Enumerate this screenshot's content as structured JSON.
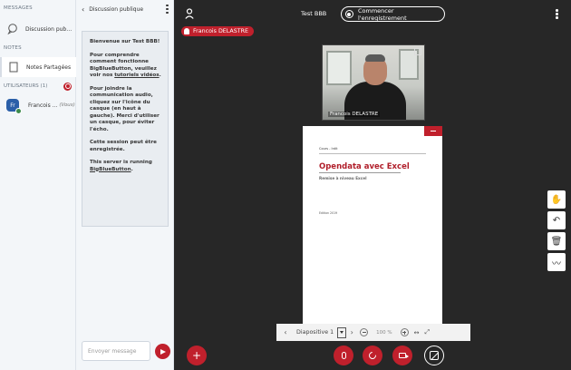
{
  "userlist": {
    "messages_title": "MESSAGES",
    "public_chat_label": "Discussion pub…",
    "notes_title": "NOTES",
    "shared_notes_label": "Notes Partagées",
    "users_title": "UTILISATEURS (1)",
    "user": {
      "initials": "Fr",
      "name": "Francois ...",
      "you": "(Vous)"
    }
  },
  "chat": {
    "back_label": "Discussion publique",
    "welcome_title": "Bienvenue sur Test BBB!",
    "p1": "Pour comprendre comment fonctionne BigBlueButton, veuillez voir nos ",
    "p1_link": "tutoriels vidéos",
    "p1_end": ".",
    "p2": "Pour joindre la communication audio, cliquez sur l'icône du casque (en haut à gauche). Merci d'utiliser un casque, pour éviter l'écho.",
    "p3": "Cette session peut être enregistrée.",
    "p4": "This server is running ",
    "p4_link": "BigBlueButton",
    "p4_end": ".",
    "input_placeholder": "Envoyer message"
  },
  "main": {
    "meeting_title": "Test BBB",
    "record_label": "Commencer l'enregistrement",
    "presenter_name": "Francois DELASTRE",
    "webcam_name": "Francois DELASTRE"
  },
  "slide": {
    "header": "Cours - Intit",
    "title": "Opendata avec Excel",
    "subtitle": "Remise à niveau Excel",
    "footer": "Edition 2019",
    "selector": "Diapositive 1",
    "zoom": "100 %"
  },
  "colors": {
    "accent": "#c0202c",
    "background": "#272727",
    "panel": "#f3f6f9"
  }
}
